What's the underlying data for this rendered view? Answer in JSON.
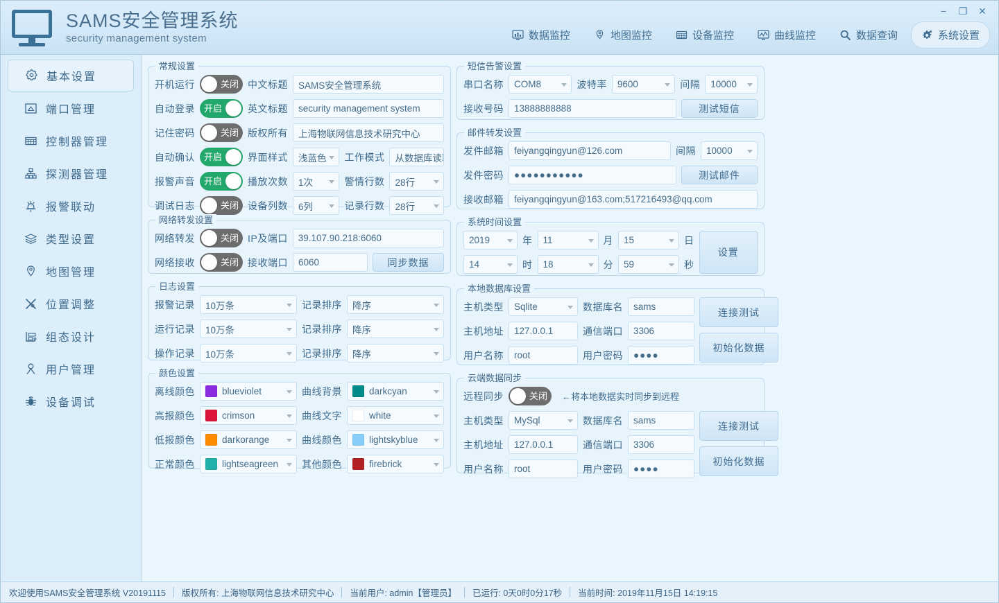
{
  "window": {
    "title_cn": "SAMS安全管理系统",
    "title_en": "security management system",
    "controls": {
      "minimize": "−",
      "maximize": "❐",
      "close": "✕"
    }
  },
  "nav": {
    "tabs": [
      {
        "label": "数据监控",
        "icon": "data-monitor-icon",
        "active": false
      },
      {
        "label": "地图监控",
        "icon": "map-monitor-icon",
        "active": false
      },
      {
        "label": "设备监控",
        "icon": "device-monitor-icon",
        "active": false
      },
      {
        "label": "曲线监控",
        "icon": "curve-monitor-icon",
        "active": false
      },
      {
        "label": "数据查询",
        "icon": "search-icon",
        "active": false
      },
      {
        "label": "系统设置",
        "icon": "gear-icon",
        "active": true
      }
    ]
  },
  "sidebar": {
    "items": [
      {
        "label": "基本设置",
        "icon": "gear-icon",
        "active": true
      },
      {
        "label": "端口管理",
        "icon": "port-icon",
        "active": false
      },
      {
        "label": "控制器管理",
        "icon": "controller-icon",
        "active": false
      },
      {
        "label": "探测器管理",
        "icon": "detector-icon",
        "active": false
      },
      {
        "label": "报警联动",
        "icon": "alarm-icon",
        "active": false
      },
      {
        "label": "类型设置",
        "icon": "layers-icon",
        "active": false
      },
      {
        "label": "地图管理",
        "icon": "map-pin-icon",
        "active": false
      },
      {
        "label": "位置调整",
        "icon": "tools-icon",
        "active": false
      },
      {
        "label": "组态设计",
        "icon": "design-icon",
        "active": false
      },
      {
        "label": "用户管理",
        "icon": "user-icon",
        "active": false
      },
      {
        "label": "设备调试",
        "icon": "bug-icon",
        "active": false
      }
    ]
  },
  "general": {
    "legend": "常规设置",
    "rows": [
      {
        "toggle_label": "开机运行",
        "toggle_state": "关闭",
        "toggle_on": false,
        "field_label": "中文标题",
        "field_value": "SAMS安全管理系统"
      },
      {
        "toggle_label": "自动登录",
        "toggle_state": "开启",
        "toggle_on": true,
        "field_label": "英文标题",
        "field_value": "security management system"
      },
      {
        "toggle_label": "记住密码",
        "toggle_state": "关闭",
        "toggle_on": false,
        "field_label": "版权所有",
        "field_value": "上海物联网信息技术研究中心"
      }
    ],
    "rows2": [
      {
        "toggle_label": "自动确认",
        "toggle_state": "开启",
        "toggle_on": true,
        "label_a": "界面样式",
        "value_a": "浅蓝色",
        "label_b": "工作模式",
        "value_b": "从数据库读取"
      },
      {
        "toggle_label": "报警声音",
        "toggle_state": "开启",
        "toggle_on": true,
        "label_a": "播放次数",
        "value_a": "1次",
        "label_b": "警情行数",
        "value_b": "28行"
      },
      {
        "toggle_label": "调试日志",
        "toggle_state": "关闭",
        "toggle_on": false,
        "label_a": "设备列数",
        "value_a": "6列",
        "label_b": "记录行数",
        "value_b": "28行"
      }
    ]
  },
  "network": {
    "legend": "网络转发设置",
    "forward_label": "网络转发",
    "forward_state": "关闭",
    "forward_on": false,
    "ip_label": "IP及端口",
    "ip_value": "39.107.90.218:6060",
    "receive_label": "网络接收",
    "receive_state": "关闭",
    "receive_on": false,
    "port_label": "接收端口",
    "port_value": "6060",
    "sync_button": "同步数据"
  },
  "log": {
    "legend": "日志设置",
    "rows": [
      {
        "label": "报警记录",
        "value": "10万条",
        "sort_label": "记录排序",
        "sort_value": "降序"
      },
      {
        "label": "运行记录",
        "value": "10万条",
        "sort_label": "记录排序",
        "sort_value": "降序"
      },
      {
        "label": "操作记录",
        "value": "10万条",
        "sort_label": "记录排序",
        "sort_value": "降序"
      }
    ]
  },
  "colors": {
    "legend": "颜色设置",
    "rows": [
      {
        "label_a": "离线颜色",
        "value_a": "blueviolet",
        "hex_a": "#8a2be2",
        "label_b": "曲线背景",
        "value_b": "darkcyan",
        "hex_b": "#008b8b"
      },
      {
        "label_a": "高报颜色",
        "value_a": "crimson",
        "hex_a": "#dc143c",
        "label_b": "曲线文字",
        "value_b": "white",
        "hex_b": "#ffffff"
      },
      {
        "label_a": "低报颜色",
        "value_a": "darkorange",
        "hex_a": "#ff8c00",
        "label_b": "曲线颜色",
        "value_b": "lightskyblue",
        "hex_b": "#87cefa"
      },
      {
        "label_a": "正常颜色",
        "value_a": "lightseagreen",
        "hex_a": "#20b2aa",
        "label_b": "其他颜色",
        "value_b": "firebrick",
        "hex_b": "#b22222"
      }
    ]
  },
  "sms": {
    "legend": "短信告警设置",
    "port_label": "串口名称",
    "port_value": "COM8",
    "baud_label": "波特率",
    "baud_value": "9600",
    "interval_label": "间隔",
    "interval_value": "10000",
    "number_label": "接收号码",
    "number_value": "13888888888",
    "test_button": "测试短信"
  },
  "mail": {
    "legend": "邮件转发设置",
    "sender_label": "发件邮箱",
    "sender_value": "feiyangqingyun@126.com",
    "interval_label": "间隔",
    "interval_value": "10000",
    "password_label": "发件密码",
    "password_value": "●●●●●●●●●●●",
    "test_button": "测试邮件",
    "receiver_label": "接收邮箱",
    "receiver_value": "feiyangqingyun@163.com;517216493@qq.com"
  },
  "time": {
    "legend": "系统时间设置",
    "year": "2019",
    "year_unit": "年",
    "month": "11",
    "month_unit": "月",
    "day": "15",
    "day_unit": "日",
    "hour": "14",
    "hour_unit": "时",
    "minute": "18",
    "minute_unit": "分",
    "second": "59",
    "second_unit": "秒",
    "set_button": "设置"
  },
  "localdb": {
    "legend": "本地数据库设置",
    "host_type_label": "主机类型",
    "host_type_value": "Sqlite",
    "db_name_label": "数据库名",
    "db_name_value": "sams",
    "host_addr_label": "主机地址",
    "host_addr_value": "127.0.0.1",
    "comm_port_label": "通信端口",
    "comm_port_value": "3306",
    "user_label": "用户名称",
    "user_value": "root",
    "pass_label": "用户密码",
    "pass_value": "●●●●",
    "test_button": "连接测试",
    "init_button": "初始化数据"
  },
  "clouddb": {
    "legend": "云端数据同步",
    "sync_label": "远程同步",
    "sync_state": "关闭",
    "sync_on": false,
    "sync_hint": "←将本地数据实时同步到远程",
    "host_type_label": "主机类型",
    "host_type_value": "MySql",
    "db_name_label": "数据库名",
    "db_name_value": "sams",
    "host_addr_label": "主机地址",
    "host_addr_value": "127.0.0.1",
    "comm_port_label": "通信端口",
    "comm_port_value": "3306",
    "user_label": "用户名称",
    "user_value": "root",
    "pass_label": "用户密码",
    "pass_value": "●●●●",
    "test_button": "连接测试",
    "init_button": "初始化数据"
  },
  "statusbar": {
    "welcome": "欢迎使用SAMS安全管理系统 V20191115",
    "copyright": "版权所有: 上海物联网信息技术研究中心",
    "current_user": "当前用户: admin【管理员】",
    "uptime": "已运行: 0天0时0分17秒",
    "current_time": "当前时间: 2019年11月15日 14:19:15"
  },
  "theme": {
    "accent": "#3f6c90",
    "toggle_on": "#23a86b",
    "toggle_off": "#6d6d6d",
    "panel_bg": "#e8f4fc",
    "page_bg": "#eaf6fd"
  }
}
